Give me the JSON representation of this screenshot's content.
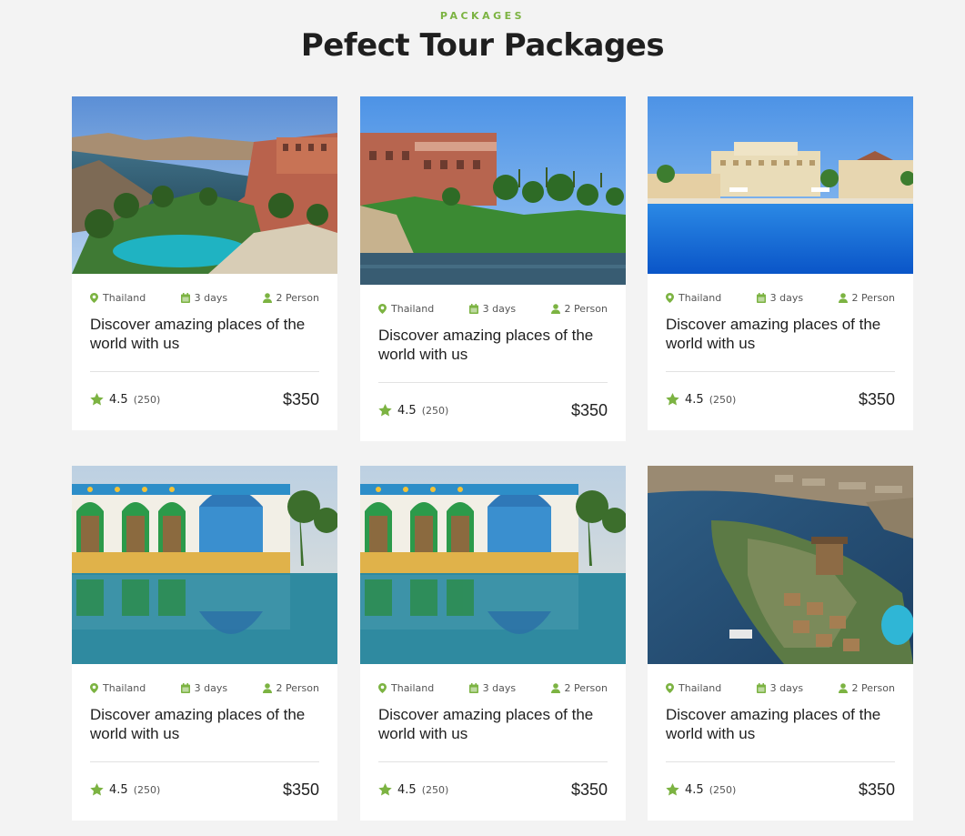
{
  "header": {
    "eyebrow": "PACKAGES",
    "title": "Pefect Tour Packages"
  },
  "colors": {
    "accent": "#7cb342",
    "background": "#f3f3f3"
  },
  "cards": [
    {
      "location": "Thailand",
      "duration": "3 days",
      "people": "2 Person",
      "title": "Discover amazing places of the world with us",
      "rating": "4.5",
      "reviews": "(250)",
      "price": "$350",
      "image": "nile-resort-pool-photo"
    },
    {
      "location": "Thailand",
      "duration": "3 days",
      "people": "2 Person",
      "title": "Discover amazing places of the world with us",
      "rating": "4.5",
      "reviews": "(250)",
      "price": "$350",
      "image": "riverside-hotel-photo"
    },
    {
      "location": "Thailand",
      "duration": "3 days",
      "people": "2 Person",
      "title": "Discover amazing places of the world with us",
      "rating": "4.5",
      "reviews": "(250)",
      "price": "$350",
      "image": "resort-pool-photo"
    },
    {
      "location": "Thailand",
      "duration": "3 days",
      "people": "2 Person",
      "title": "Discover amazing places of the world with us",
      "rating": "4.5",
      "reviews": "(250)",
      "price": "$350",
      "image": "nubian-house-reflection-photo"
    },
    {
      "location": "Thailand",
      "duration": "3 days",
      "people": "2 Person",
      "title": "Discover amazing places of the world with us",
      "rating": "4.5",
      "reviews": "(250)",
      "price": "$350",
      "image": "nubian-house-reflection-photo"
    },
    {
      "location": "Thailand",
      "duration": "3 days",
      "people": "2 Person",
      "title": "Discover amazing places of the world with us",
      "rating": "4.5",
      "reviews": "(250)",
      "price": "$350",
      "image": "island-aerial-photo"
    }
  ]
}
